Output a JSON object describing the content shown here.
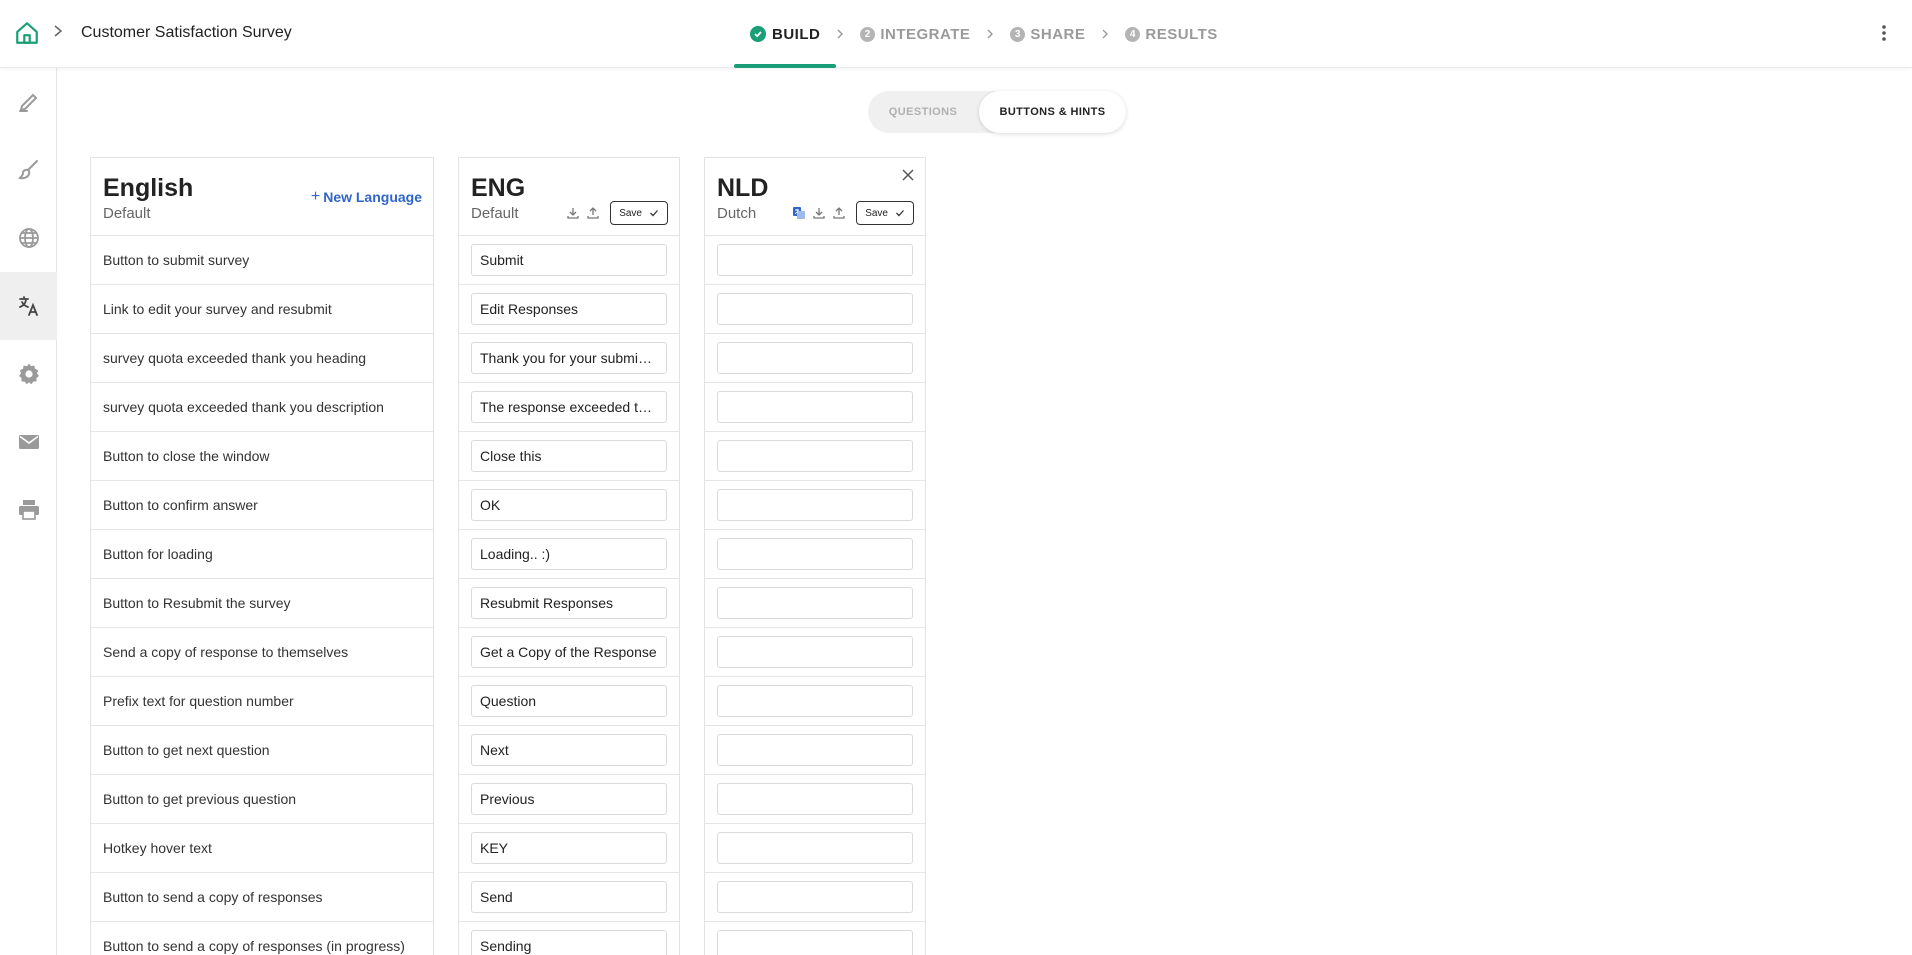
{
  "header": {
    "survey_title": "Customer Satisfaction Survey",
    "steps": [
      {
        "label": "BUILD",
        "num": "",
        "active": true
      },
      {
        "label": "INTEGRATE",
        "num": "2"
      },
      {
        "label": "SHARE",
        "num": "3"
      },
      {
        "label": "RESULTS",
        "num": "4"
      }
    ]
  },
  "sidebar": {
    "icons": [
      "pen-icon",
      "paint-brush-icon",
      "globe-icon",
      "translate-icon",
      "gear-icon",
      "mail-icon",
      "print-icon"
    ],
    "active_index": 3
  },
  "toggle": {
    "questions": "QUESTIONS",
    "buttons_hints": "BUTTONS & HINTS"
  },
  "columns": {
    "english": {
      "title": "English",
      "sub": "Default",
      "new_language": "New Language"
    },
    "eng": {
      "title": "ENG",
      "sub": "Default",
      "save": "Save"
    },
    "nld": {
      "title": "NLD",
      "sub": "Dutch",
      "save": "Save"
    }
  },
  "rows": [
    {
      "label": "Button to submit survey",
      "eng": "Submit",
      "nld": ""
    },
    {
      "label": "Link to edit your survey and resubmit",
      "eng": "Edit Responses",
      "nld": ""
    },
    {
      "label": "survey quota exceeded thank you heading",
      "eng": "Thank you for your submission",
      "nld": ""
    },
    {
      "label": "survey quota exceeded thank you description",
      "eng": "The response exceeded the quota",
      "nld": ""
    },
    {
      "label": "Button to close the window",
      "eng": "Close this",
      "nld": ""
    },
    {
      "label": "Button to confirm answer",
      "eng": "OK",
      "nld": ""
    },
    {
      "label": "Button for loading",
      "eng": "Loading.. :)",
      "nld": ""
    },
    {
      "label": "Button to Resubmit the survey",
      "eng": "Resubmit Responses",
      "nld": ""
    },
    {
      "label": "Send a copy of response to themselves",
      "eng": "Get a Copy of the Response",
      "nld": ""
    },
    {
      "label": "Prefix text for question number",
      "eng": "Question",
      "nld": ""
    },
    {
      "label": "Button to get next question",
      "eng": "Next",
      "nld": ""
    },
    {
      "label": "Button to get previous question",
      "eng": "Previous",
      "nld": ""
    },
    {
      "label": "Hotkey hover text",
      "eng": "KEY",
      "nld": ""
    },
    {
      "label": "Button to send a copy of responses",
      "eng": "Send",
      "nld": ""
    },
    {
      "label": "Button to send a copy of responses (in progress)",
      "eng": "Sending",
      "nld": ""
    }
  ],
  "colors": {
    "accent": "#1a9e77",
    "link": "#2f66c9"
  }
}
